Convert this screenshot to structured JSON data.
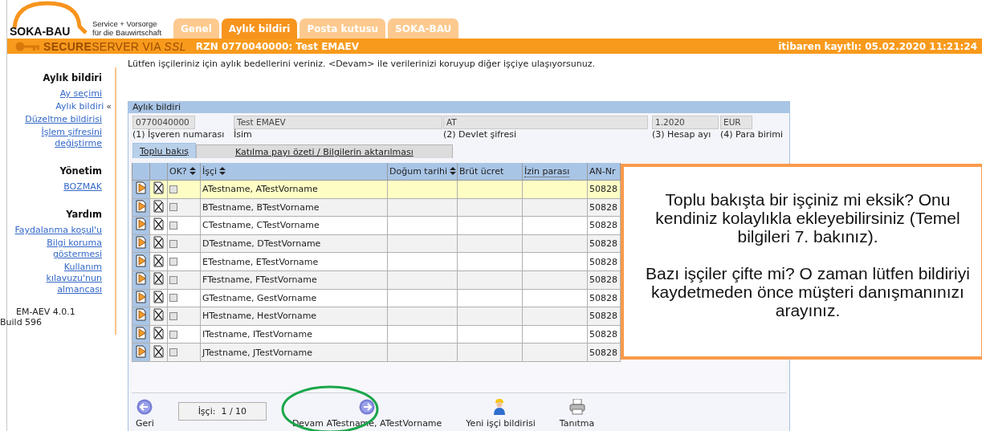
{
  "header": {
    "logo_name": "SOKA-BAU",
    "tagline": [
      "Service + Vorsorge",
      "für die Bauwirtschaft"
    ],
    "tabs": [
      {
        "label": "Genel",
        "selected": false
      },
      {
        "label": "Aylık bildiri",
        "selected": true
      },
      {
        "label": "Posta kutusu",
        "selected": false
      },
      {
        "label": "SOKA-BAU",
        "selected": false
      }
    ],
    "secure_brand": "**SECURE**SERVER VIA *SSL*",
    "session": "RZN 0770040000: Test EMAEV",
    "login_info": "itibaren kayıtlı:  05.02.2020 11:21:24"
  },
  "sidebar": {
    "sections": [
      {
        "heading": "Aylık bildiri",
        "items": [
          {
            "label": "Ay seçimi",
            "selected": false
          },
          {
            "label": "Aylık bildiri",
            "selected": true,
            "marker": "«"
          },
          {
            "label": "Düzeltme bildirisi",
            "selected": false
          },
          {
            "label": "İşlem şifresini değiştirme",
            "selected": false
          }
        ]
      },
      {
        "heading": "Yönetim",
        "items": [
          {
            "label": "BOZMAK",
            "selected": false
          }
        ]
      },
      {
        "heading": "Yardım",
        "items": [
          {
            "label": "Faydalanma koşul'u",
            "selected": false
          },
          {
            "label": "Bilgi koruma göstermesi",
            "selected": false
          },
          {
            "label": "Kullanım kılavuzu'nun almancası",
            "selected": false
          }
        ]
      }
    ],
    "version": [
      "EM-AEV 4.0.1",
      "Build 596"
    ]
  },
  "intro": "Lütfen işçileriniz için aylık bedellerini veriniz. <Devam> ile verilerinizi koruyup diğer işçiye ulaşıyorsunuz.",
  "panel": {
    "title": "Aylık bildiri",
    "fields": [
      {
        "value": "0770040000",
        "label": "(1) İşveren numarası"
      },
      {
        "value": "Test EMAEV",
        "label": "İsim"
      },
      {
        "value": "AT",
        "label": "(2) Devlet şifresi"
      },
      {
        "value": "1.2020",
        "label": "(3) Hesap ayı"
      },
      {
        "value": "EUR",
        "label": "(4) Para birimi"
      }
    ],
    "tabs": [
      {
        "label": "Toplu bakış",
        "selected": true
      },
      {
        "label": "Katılma payı özeti / Bilgilerin aktarılması",
        "selected": false
      }
    ],
    "table": {
      "columns": [
        {
          "label": "OK?",
          "sortable": true
        },
        {
          "label": "İşçi",
          "sortable": true
        },
        {
          "label": "Doğum tarihi",
          "sortable": true
        },
        {
          "label": "Brüt ücret",
          "sortable": false
        },
        {
          "label": "İzin parası",
          "sortable": false,
          "hint": true
        },
        {
          "label": "AN-Nr",
          "sortable": false
        }
      ],
      "rows": [
        {
          "name": "ATestname, ATestVorname",
          "an_nr": "50828",
          "checked": false,
          "selected": true
        },
        {
          "name": "BTestname, BTestVorname",
          "an_nr": "50828",
          "checked": false,
          "selected": false
        },
        {
          "name": "CTestname, CTestVorname",
          "an_nr": "50828",
          "checked": false,
          "selected": false
        },
        {
          "name": "DTestname, DTestVorname",
          "an_nr": "50828",
          "checked": false,
          "selected": false
        },
        {
          "name": "ETestname, ETestVorname",
          "an_nr": "50828",
          "checked": false,
          "selected": false
        },
        {
          "name": "FTestname, FTestVorname",
          "an_nr": "50828",
          "checked": false,
          "selected": false
        },
        {
          "name": "GTestname, GestVorname",
          "an_nr": "50828",
          "checked": false,
          "selected": false
        },
        {
          "name": "HTestname, HestVorname",
          "an_nr": "50828",
          "checked": false,
          "selected": false
        },
        {
          "name": "ITestname, ITestVorname",
          "an_nr": "50828",
          "checked": false,
          "selected": false
        },
        {
          "name": "JTestname, JTestVorname",
          "an_nr": "50828",
          "checked": false,
          "selected": false
        }
      ]
    },
    "toolbar": [
      {
        "kind": "back",
        "label": "Geri",
        "highlighted": false
      },
      {
        "kind": "counter",
        "label": "İşçi:  1 / 10"
      },
      {
        "kind": "next",
        "label": "Devam ATestname, ATestVorname",
        "highlighted": true
      },
      {
        "kind": "new-worker",
        "label": "Yeni işçi bildirisi",
        "highlighted": false
      },
      {
        "kind": "print",
        "label": "Tanıtma",
        "highlighted": false
      }
    ]
  },
  "callout": {
    "paragraphs": [
      "Toplu bakışta bir işçiniz mi eksik? Onu kendiniz kolaylıkla ekleyebilirsiniz (Temel bilgileri 7. bakınız).",
      "Bazı işçiler çifte mi? O zaman lütfen bildiriyi kaydetmeden önce müşteri danışmanınızı arayınız."
    ]
  }
}
